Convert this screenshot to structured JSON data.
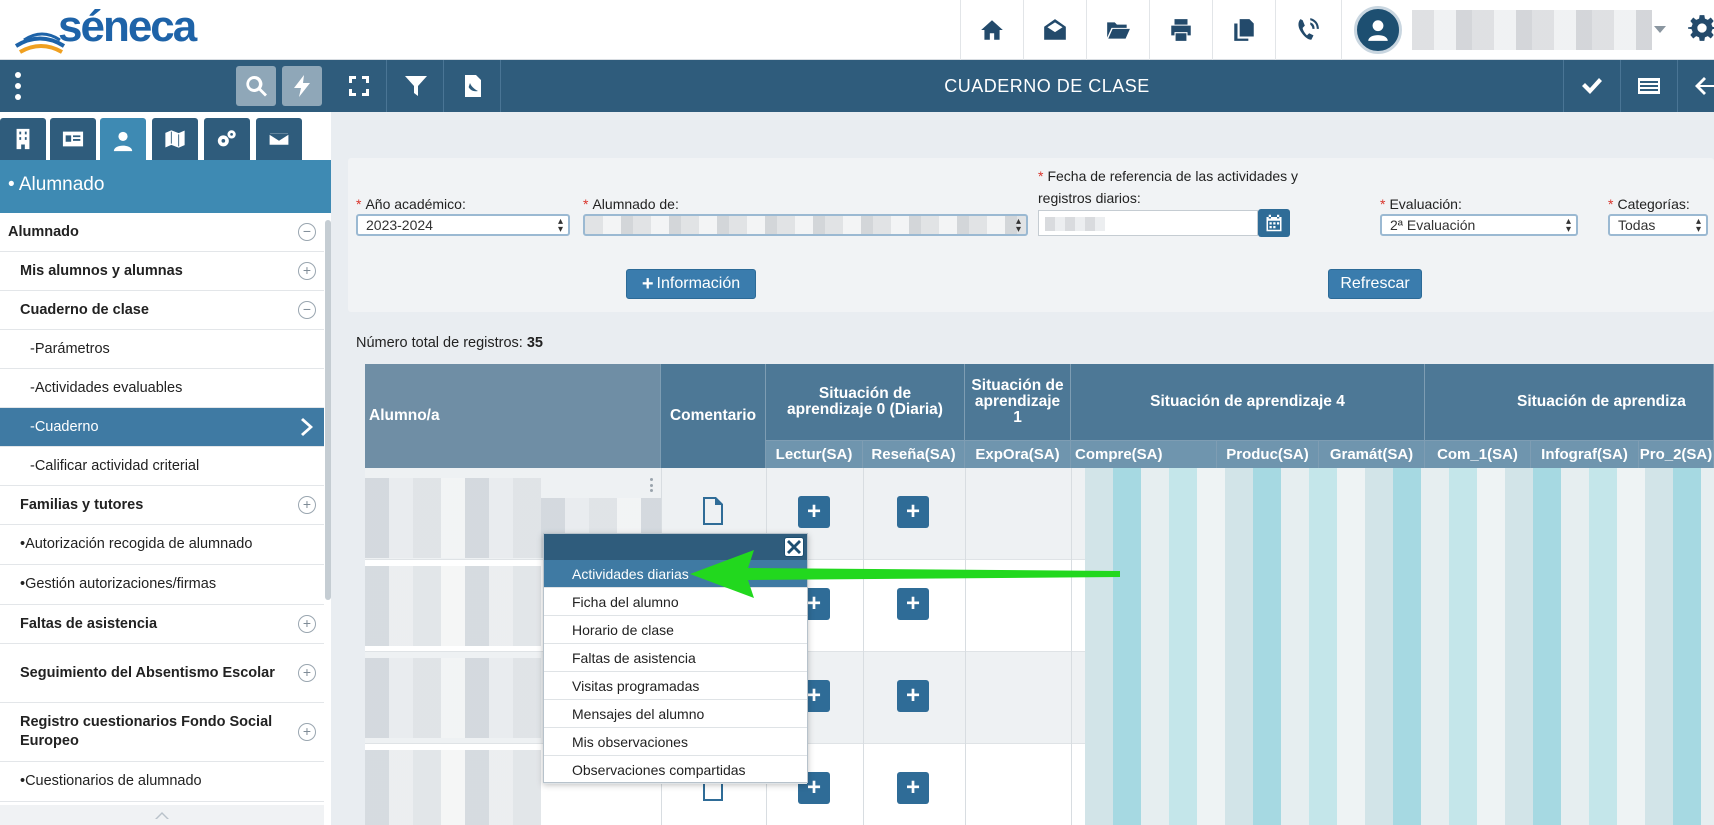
{
  "app": {
    "logo_text": "séneca"
  },
  "header": {
    "icons": [
      "home-icon",
      "envelope-open-icon",
      "folder-open-icon",
      "print-icon",
      "copy-icon",
      "phone-volume-icon"
    ],
    "right_icon": "gear-icon"
  },
  "sidebar": {
    "section_title": "• Alumnado",
    "tabs": [
      "building-icon",
      "id-card-icon",
      "student-icon",
      "map-icon",
      "gears-icon",
      "envelope-icon"
    ],
    "items": [
      {
        "label": "Alumnado",
        "level": "l0",
        "toggle": "−"
      },
      {
        "label": "Mis alumnos y alumnas",
        "level": "l1",
        "toggle": "+"
      },
      {
        "label": "Cuaderno de clase",
        "level": "l1",
        "toggle": "−"
      },
      {
        "label": "-Parámetros",
        "level": "l2"
      },
      {
        "label": "-Actividades evaluables",
        "level": "l2"
      },
      {
        "label": "-Cuaderno",
        "level": "l2",
        "active": true
      },
      {
        "label": "-Calificar actividad criterial",
        "level": "l2"
      },
      {
        "label": "Familias y tutores",
        "level": "l1",
        "toggle": "+"
      },
      {
        "label": "•Autorización recogida de alumnado",
        "level": "l3"
      },
      {
        "label": "•Gestión autorizaciones/firmas",
        "level": "l3"
      },
      {
        "label": "Faltas de asistencia",
        "level": "l1",
        "toggle": "+"
      },
      {
        "label": "Seguimiento del Absentismo Escolar",
        "level": "l1",
        "toggle": "+"
      },
      {
        "label": "Registro cuestionarios Fondo Social Europeo",
        "level": "l1",
        "toggle": "+"
      },
      {
        "label": "•Cuestionarios de alumnado",
        "level": "l3"
      }
    ]
  },
  "main": {
    "title": "CUADERNO DE CLASE"
  },
  "filters": {
    "year_label": "Año académico:",
    "year_value": "2023-2024",
    "students_label": "Alumnado de:",
    "date_label_line1": "Fecha de referencia de las actividades y",
    "date_label_line2": "registros diarios:",
    "eval_label": "Evaluación:",
    "eval_value": "2ª Evaluación",
    "cat_label": "Categorías:",
    "cat_value": "Todas",
    "info_button": "Información",
    "refresh_button": "Refrescar"
  },
  "records": {
    "label": "Número total de registros:",
    "count": "35"
  },
  "table": {
    "student_header": "Alumno/a",
    "comment_header": "Comentario",
    "sa0": "Situación de aprendizaje 0 (Diaria)",
    "sa1": "Situación de aprendizaje 1",
    "sa4": "Situación de aprendizaje 4",
    "sa_next": "Situación de aprendiza",
    "sub": [
      "Lectur(SA)",
      "Reseña(SA)",
      "ExpOra(SA)",
      "Compre(SA)",
      "Produc(SA)",
      "Gramát(SA)",
      "Com_1(SA)",
      "Infograf(SA)",
      "Pro_2(SA)"
    ]
  },
  "context_menu": {
    "items": [
      "Actividades diarias",
      "Ficha del alumno",
      "Horario de clase",
      "Faltas de asistencia",
      "Visitas programadas",
      "Mensajes del alumno",
      "Mis observaciones",
      "Observaciones compartidas"
    ],
    "highlight_color": "#3f7aa3",
    "arrow_color": "#22d81e"
  }
}
